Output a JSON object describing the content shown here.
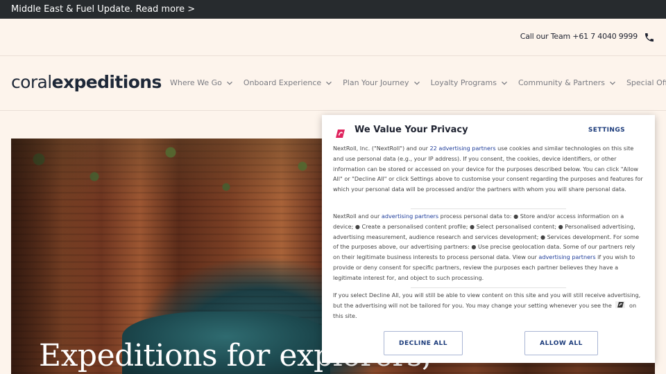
{
  "announcement": {
    "text": "Middle East & Fuel Update. Read more >"
  },
  "contact": {
    "text": "Call our Team +61 7 4040 9999",
    "icon": "phone-icon"
  },
  "logo": {
    "part1": "coral",
    "part2": "expeditions"
  },
  "nav": {
    "items": [
      {
        "label": "Where We Go"
      },
      {
        "label": "Onboard Experience"
      },
      {
        "label": "Plan Your Journey"
      },
      {
        "label": "Loyalty Programs"
      },
      {
        "label": "Community & Partners"
      },
      {
        "label": "Special Offers"
      }
    ]
  },
  "hero": {
    "title": "Expeditions for explorers,"
  },
  "consent": {
    "title": "We Value Your Privacy",
    "settings_label": "SETTINGS",
    "p1_a": "NextRoll, Inc. (\"NextRoll\") and our ",
    "p1_link": "22 advertising partners",
    "p1_b": " use cookies and similar technologies on this site and use personal data (e.g., your IP address). If you consent, the cookies, device identifiers, or other information can be stored or accessed on your device for the purposes described below. You can click \"Allow All\" or \"Decline All\" or click Settings above to customise your consent regarding the purposes and features for which your personal data will be processed and/or the partners with whom you will share personal data.",
    "p2_a": "NextRoll and our ",
    "p2_link1": "advertising partners",
    "p2_b": " process personal data to: ● Store and/or access information on a device; ● Create a personalised content profile; ● Select personalised content; ● Personalised advertising, advertising measurement, audience research and services development; ● Services development. For some of the purposes above, our advertising partners: ● Use precise geolocation data. Some of our partners rely on their legitimate business interests to process personal data. View our ",
    "p2_link2": "advertising partners",
    "p2_c": " if you wish to provide or deny consent for specific partners, review the purposes each partner believes they have a legitimate interest for, and object to such processing.",
    "p3_a": "If you select Decline All, you will still be able to view content on this site and you will still receive advertising, but the advertising will not be tailored for you. You may change your setting whenever you see the",
    "p3_b": "on this site.",
    "decline_label": "DECLINE ALL",
    "allow_label": "ALLOW ALL"
  },
  "colors": {
    "brand_pink": "#e0245e",
    "link_blue": "#1f3d9a",
    "topbar_bg": "#272b2e"
  }
}
